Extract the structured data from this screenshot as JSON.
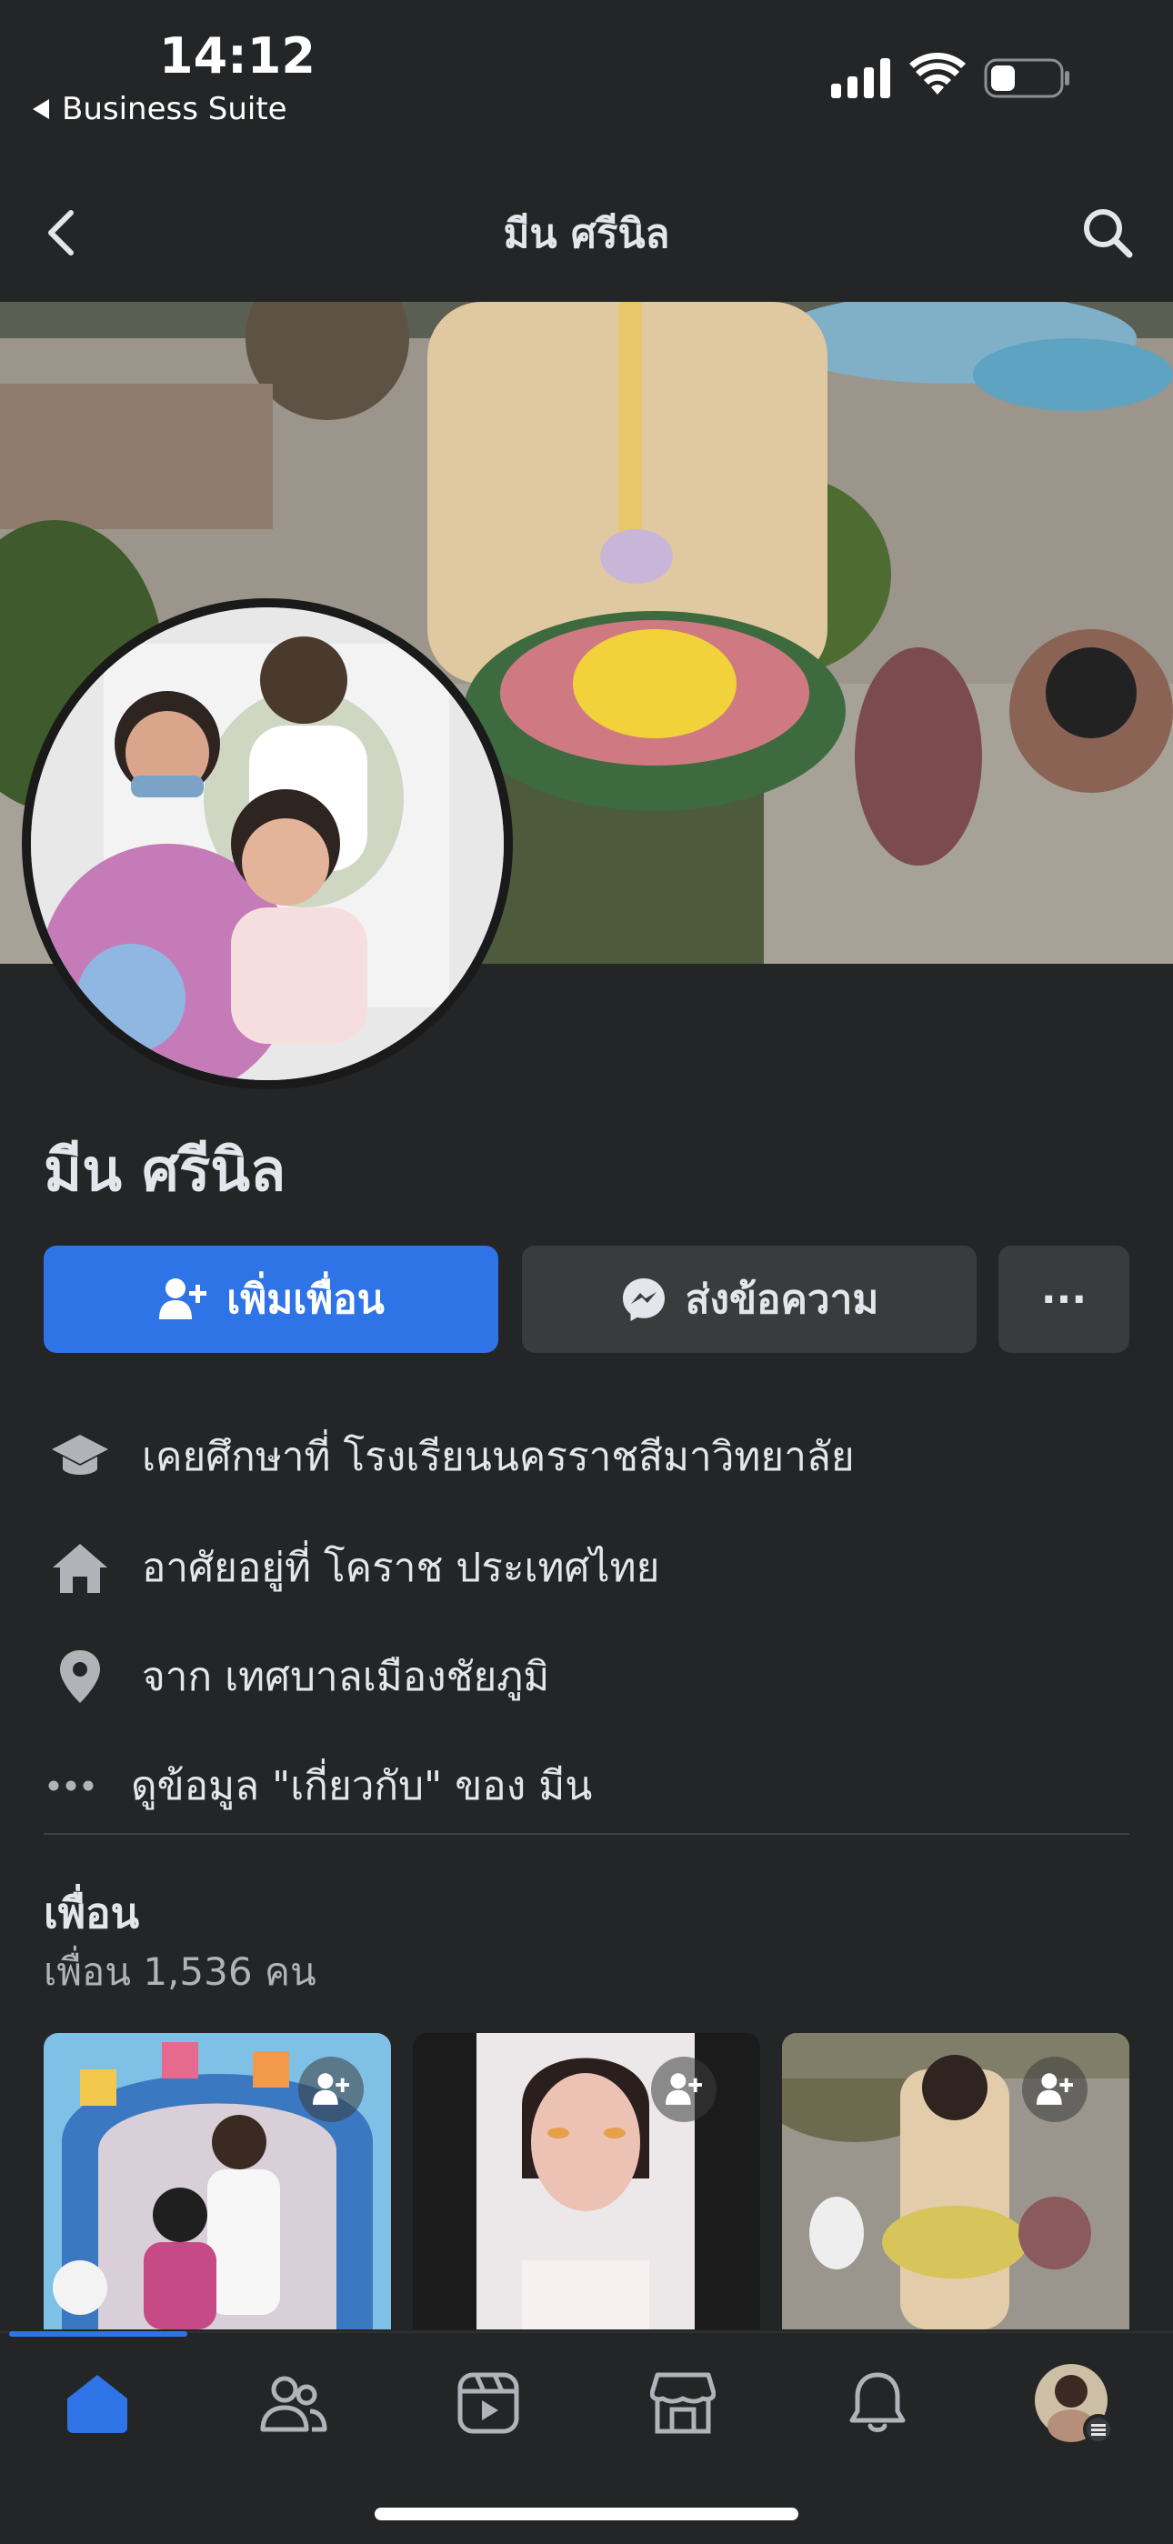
{
  "status_bar": {
    "time": "14:12",
    "back_app": "Business Suite"
  },
  "header": {
    "title": "มีน ศรีนิล"
  },
  "profile": {
    "name": "มีน ศรีนิล"
  },
  "actions": {
    "add_friend": "เพิ่มเพื่อน",
    "message": "ส่งข้อความ",
    "more": "···"
  },
  "info": [
    {
      "icon": "graduation-cap-icon",
      "text": "เคยศึกษาที่ โรงเรียนนครราชสีมาวิทยาลัย"
    },
    {
      "icon": "home-icon",
      "text": "อาศัยอยู่ที่ โคราช ประเทศไทย"
    },
    {
      "icon": "location-pin-icon",
      "text": "จาก เทศบาลเมืองชัยภูมิ"
    },
    {
      "icon": "more-dots-icon",
      "text": "ดูข้อมูล \"เกี่ยวกับ\" ของ มีน"
    }
  ],
  "friends": {
    "title": "เพื่อน",
    "count": "เพื่อน 1,536 คน"
  },
  "colors": {
    "background": "#242526",
    "accent": "#2e74e6",
    "secondary_button": "#3a3b3c",
    "text": "#e4e6eb",
    "muted_text": "#b0b3b8"
  },
  "tabs": [
    {
      "name": "home-icon",
      "active": true
    },
    {
      "name": "friends-icon",
      "active": false
    },
    {
      "name": "watch-icon",
      "active": false
    },
    {
      "name": "marketplace-icon",
      "active": false
    },
    {
      "name": "notifications-icon",
      "active": false
    },
    {
      "name": "profile-menu-icon",
      "active": false
    }
  ]
}
